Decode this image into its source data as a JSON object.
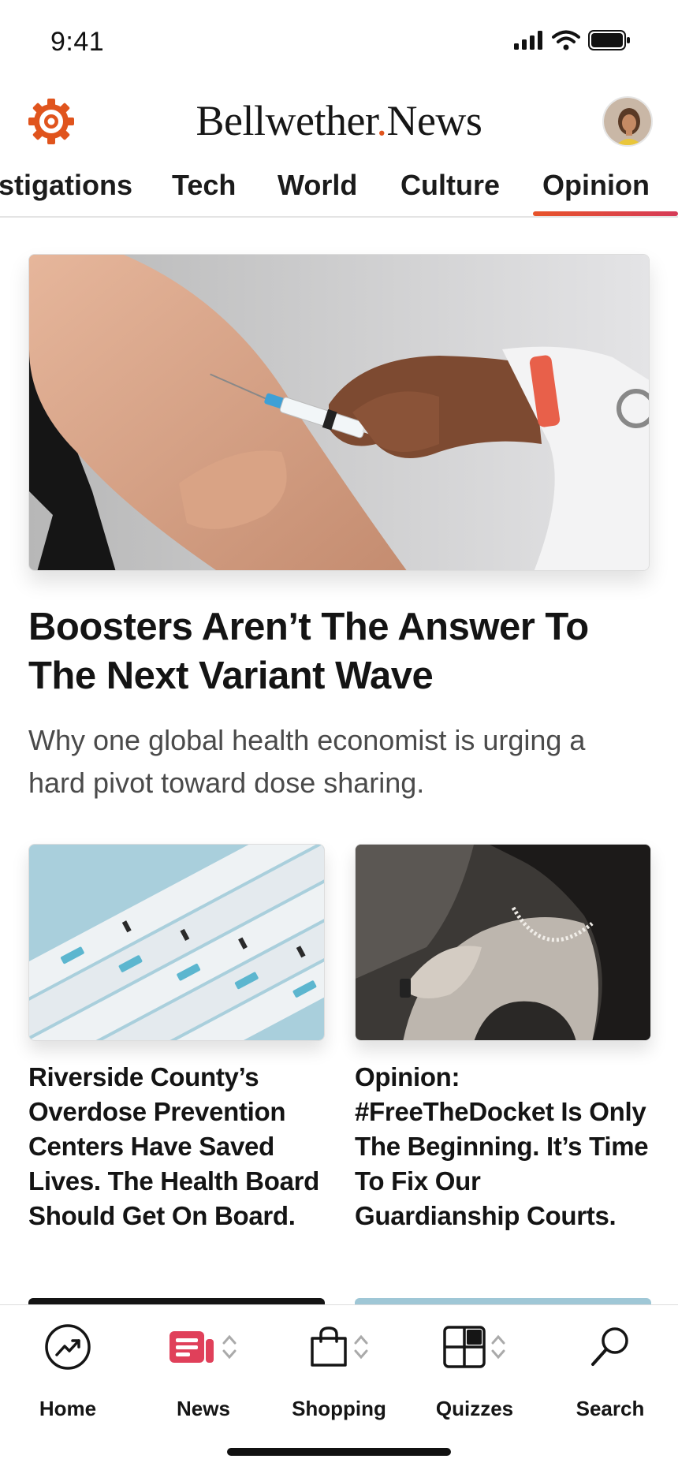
{
  "status_bar": {
    "time": "9:41"
  },
  "header": {
    "brand_left": "Bellwether",
    "brand_dot": ".",
    "brand_right": "News"
  },
  "tabs": [
    {
      "label": "stigations"
    },
    {
      "label": "Tech"
    },
    {
      "label": "World"
    },
    {
      "label": "Culture"
    },
    {
      "label": "Opinion",
      "selected": true
    }
  ],
  "hero": {
    "title": "Boosters Aren’t The Answer To The Next Variant Wave",
    "subtitle": "Why one global health economist is urging a hard pivot toward dose sharing."
  },
  "cards": [
    {
      "title": "Riverside County’s Overdose Prevention Centers Have Saved Lives. The Health Board Should Get On Board."
    },
    {
      "title": "Opinion: #FreeTheDocket Is Only The Beginning. It’s Time To Fix Our Guardianship Courts."
    }
  ],
  "tab_bar": {
    "items": [
      {
        "label": "Home",
        "icon": "trending-circle-icon"
      },
      {
        "label": "News",
        "icon": "news-icon"
      },
      {
        "label": "Shopping",
        "icon": "shopping-bag-icon"
      },
      {
        "label": "Quizzes",
        "icon": "quiz-grid-icon"
      },
      {
        "label": "Search",
        "icon": "search-icon"
      }
    ]
  },
  "colors": {
    "accent": "#e0541d",
    "news_icon": "#e0405a",
    "underline_start": "#e7532a",
    "underline_end": "#d63b58"
  }
}
